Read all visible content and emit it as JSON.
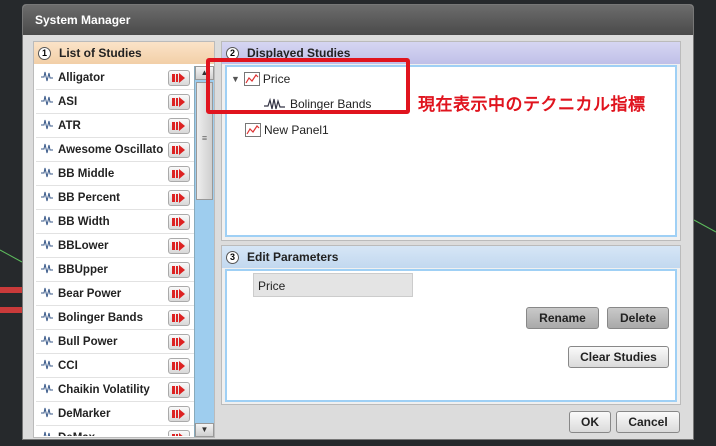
{
  "window": {
    "title": "System Manager"
  },
  "list_panel": {
    "number": "1",
    "title": "List of Studies",
    "items": [
      "Alligator",
      "ASI",
      "ATR",
      "Awesome Oscillator",
      "BB Middle",
      "BB Percent",
      "BB Width",
      "BBLower",
      "BBUpper",
      "Bear Power",
      "Bolinger Bands",
      "Bull Power",
      "CCI",
      "Chaikin Volatility",
      "DeMarker",
      "DeMax"
    ],
    "scrollbar": {
      "up": "▲",
      "down": "▼",
      "grip": "≡"
    }
  },
  "displayed_panel": {
    "number": "2",
    "title": "Displayed Studies",
    "tree": {
      "expander": "▼",
      "price_label": "Price",
      "child_label": "Bolinger Bands",
      "panel_label": "New Panel1"
    },
    "annotation": "現在表示中のテクニカル指標"
  },
  "edit_panel": {
    "number": "3",
    "title": "Edit Parameters",
    "param_name": "Price",
    "rename_label": "Rename",
    "delete_label": "Delete",
    "clear_label": "Clear Studies"
  },
  "footer": {
    "ok_label": "OK",
    "cancel_label": "Cancel"
  },
  "colors": {
    "highlight": "#e0141e",
    "accent_blue": "#9fd0f5"
  }
}
